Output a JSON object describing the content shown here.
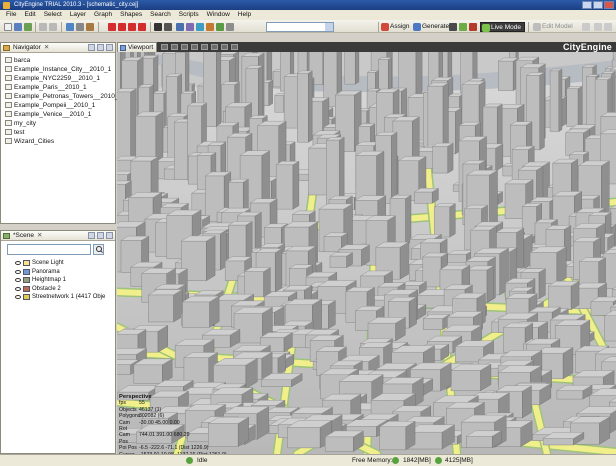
{
  "window": {
    "title": "CityEngine TRIAL 2010.3 - [schematic_city.cej]"
  },
  "menu": [
    "File",
    "Edit",
    "Select",
    "Layer",
    "Graph",
    "Shapes",
    "Search",
    "Scripts",
    "Window",
    "Help"
  ],
  "toolbar": {
    "assign_label": "Assign",
    "generate_label": "Generate",
    "live_mode_label": "Live Mode",
    "edit_model_label": "Edit Model"
  },
  "navigator": {
    "tab_label": "Navigator",
    "items": [
      "barca",
      "Example_Instance_City__2010_1",
      "Example_NYC2259__2010_1",
      "Example_Paris__2010_1",
      "Example_Petronas_Towers__2010_1",
      "Example_Pompeii__2010_1",
      "Example_Venice__2010_1",
      "my_city",
      "test",
      "Wizard_Cities"
    ]
  },
  "scene": {
    "tab_label": "*Scene",
    "items": [
      "Scene Light",
      "Panorama",
      "Heightmap 1",
      "Obstacle 2",
      "Streetnetwork 1 (4417 Obje"
    ]
  },
  "viewport": {
    "tab_label": "Viewport",
    "logo": "CityEngine",
    "info": {
      "title": "Perspective",
      "rows": [
        {
          "k": "fps",
          "v": "55"
        },
        {
          "k": "Objects",
          "v": "46137 (1)"
        },
        {
          "k": "Polygons",
          "v": "302082 (6)"
        },
        {
          "k": "Cam Rot",
          "v": "-30.00 45.00 0.00"
        },
        {
          "k": "Cam Pos",
          "v": "744.01 391.00 680.29"
        },
        {
          "k": "Poi Pos",
          "v": "-6.5 -222.6 -71.1 (Dist 1226.9)"
        },
        {
          "k": "Cursor",
          "v": "-1523.91 10.98 -1137.16 (Dist 1261.0)"
        }
      ]
    }
  },
  "status": {
    "idle_label": "Idle",
    "free_memory_label": "Free Memory:",
    "memory_1": "1842[MB]",
    "memory_2": "4125[MB]"
  },
  "colors": {
    "road": "#f1ee8c",
    "road_edge": "#9ec37a",
    "building_top": "#cfcfcf",
    "building_side": "#8f8f8f",
    "terrain": "#a6a6a6",
    "water": "#b2b2b2"
  }
}
